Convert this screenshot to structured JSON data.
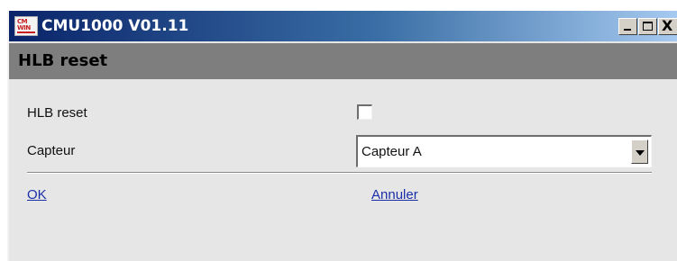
{
  "window": {
    "title": "CMU1000 V01.11",
    "app_icon": {
      "name": "cmwin-app-icon",
      "line1": "CM",
      "line2": "WIN"
    },
    "controls": {
      "minimize_icon": "minimize-icon",
      "maximize_icon": "maximize-icon",
      "close_icon": "close-icon",
      "close_glyph": "X"
    }
  },
  "header": {
    "title": "HLB reset"
  },
  "form": {
    "hlb_reset": {
      "label": "HLB reset",
      "checked": false
    },
    "capteur": {
      "label": "Capteur",
      "selected": "Capteur A"
    }
  },
  "actions": {
    "ok_label": "OK",
    "cancel_label": "Annuler"
  },
  "colors": {
    "titlebar_start": "#0a246a",
    "titlebar_end": "#a6caf0",
    "header_bg": "#7e7e7e",
    "window_bg": "#e6e6e6",
    "link": "#1a2fa8"
  }
}
